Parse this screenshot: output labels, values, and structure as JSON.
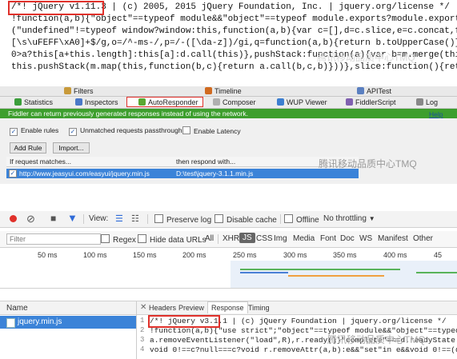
{
  "code_panel": {
    "lines": [
      "/*! jQuery v1.11.3 | (c) 2005, 2015 jQuery Foundation, Inc. | jquery.org/license */",
      "!function(a,b){\"object\"==typeof module&&\"object\"==typeof module.exports?module.exports=a.docu",
      "(\"undefined\"!=typeof window?window:this,function(a,b){var c=[],d=c.slice,e=c.concat,f=c.push,",
      "[\\s\\uFEFF\\xA0]+$/g,o=/^-ms-/,p=/-([\\da-z])/gi,q=function(a,b){return b.toUpperCase()};m.fn=m.",
      "0>a?this[a+this.length]:this[a]:d.call(this)},pushStack:function(a){var b=m.merge(this.constr",
      "this.pushStack(m.map(this,function(b,c){return a.call(b,c,b)}))},slice:function(){return this"
    ]
  },
  "fiddler": {
    "top_tabs": [
      {
        "label": "Filters",
        "icon": "filter-icon",
        "color": "#c89a3a"
      },
      {
        "label": "Timeline",
        "icon": "timeline-icon",
        "color": "#d06a20"
      },
      {
        "label": "APITest",
        "icon": "apitest-icon",
        "color": "#5a7fc0"
      }
    ],
    "main_tabs": [
      {
        "label": "Statistics",
        "icon": "statistics-icon",
        "color": "#3b9e3b"
      },
      {
        "label": "Inspectors",
        "icon": "inspectors-icon",
        "color": "#4a78c8"
      },
      {
        "label": "AutoResponder",
        "icon": "lightning-icon",
        "color": "#5aa832"
      },
      {
        "label": "Composer",
        "icon": "composer-icon",
        "color": "#b0b0b0"
      },
      {
        "label": "WUP Viewer",
        "icon": "wup-viewer-icon",
        "color": "#3d7fd0"
      },
      {
        "label": "FiddlerScript",
        "icon": "fiddlerscript-icon",
        "color": "#8060b0"
      },
      {
        "label": "Log",
        "icon": "log-icon",
        "color": "#888888"
      }
    ],
    "banner_text": "Fiddler can return previously generated responses instead of using the network.",
    "help_link": "Help",
    "options": {
      "enable_rules": "Enable rules",
      "unmatched": "Unmatched requests passthrough",
      "latency": "Enable Latency"
    },
    "buttons": {
      "add_rule": "Add Rule",
      "import": "Import..."
    },
    "columns": {
      "match": "If request matches...",
      "respond": "then respond with..."
    },
    "rule": {
      "match": "http://www.jeasyui.com/easyui/jquery.min.js",
      "respond": "D:\\test\\jquery-3.1.1.min.js"
    }
  },
  "devtools": {
    "toolbar": {
      "view_label": "View:",
      "preserve_log": "Preserve log",
      "disable_cache": "Disable cache",
      "offline": "Offline",
      "throttle": "No throttling"
    },
    "filter": {
      "placeholder": "Filter",
      "regex": "Regex",
      "hide_data_urls": "Hide data URLs",
      "types": [
        "All",
        "XHR",
        "JS",
        "CSS",
        "Img",
        "Media",
        "Font",
        "Doc",
        "WS",
        "Manifest",
        "Other"
      ],
      "active_type": "JS"
    },
    "timeline_ticks": [
      "50 ms",
      "100 ms",
      "150 ms",
      "200 ms",
      "250 ms",
      "300 ms",
      "350 ms",
      "400 ms",
      "45"
    ],
    "name_column": "Name",
    "file": "jquery.min.js",
    "response_tabs": [
      "Headers",
      "Preview",
      "Response",
      "Timing"
    ],
    "active_response_tab": "Response",
    "response_lines": [
      {
        "num": "1",
        "text": "/*! jQuery v3.1.1 | (c) jQuery Foundation | jquery.org/license */"
      },
      {
        "num": "2",
        "text": "!function(a,b){\"use strict\";\"object\"==typeof module&&\"object\"==typeof mo"
      },
      {
        "num": "3",
        "text": "a.removeEventListener(\"load\",R),r.ready()}\"complete\"===d.readyState||\"lo"
      },
      {
        "num": "4",
        "text": "void 0!==c?null===c?void r.removeAttr(a,b):e&&\"set\"in e&&void 0!==(d=e.s"
      }
    ]
  },
  "watermark": "腾讯移动品质中心TMQ"
}
